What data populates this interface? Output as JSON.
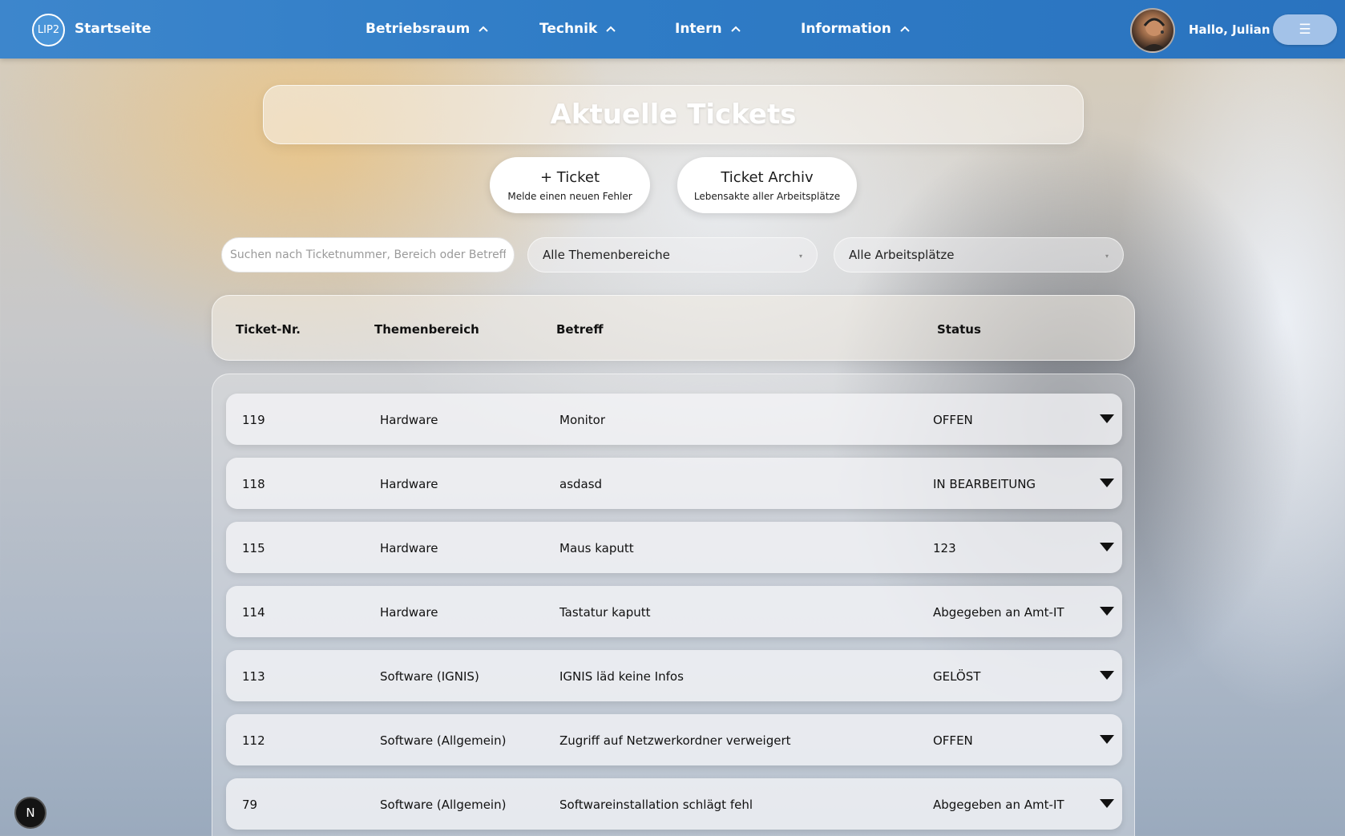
{
  "navbar": {
    "logo_text": "LIP2",
    "brand": "Startseite",
    "items": [
      {
        "label": "Betriebsraum"
      },
      {
        "label": "Technik"
      },
      {
        "label": "Intern"
      },
      {
        "label": "Information"
      }
    ],
    "greeting": "Hallo, Julian",
    "menu_icon": "☰"
  },
  "page": {
    "title": "Aktuelle Tickets",
    "new_ticket": {
      "label": "+ Ticket",
      "sub": "Melde einen neuen Fehler"
    },
    "archive": {
      "label": "Ticket Archiv",
      "sub": "Lebensakte aller Arbeitsplätze"
    }
  },
  "filters": {
    "search_placeholder": "Suchen nach Ticketnummer, Bereich oder Betreff",
    "topic_selected": "Alle Themenbereiche",
    "workplace_selected": "Alle Arbeitsplätze"
  },
  "table": {
    "headers": {
      "nr": "Ticket-Nr.",
      "area": "Themenbereich",
      "subject": "Betreff",
      "status": "Status"
    },
    "rows": [
      {
        "nr": "119",
        "area": "Hardware",
        "subject": "Monitor",
        "status": "OFFEN"
      },
      {
        "nr": "118",
        "area": "Hardware",
        "subject": "asdasd",
        "status": "IN BEARBEITUNG"
      },
      {
        "nr": "115",
        "area": "Hardware",
        "subject": "Maus kaputt",
        "status": "123"
      },
      {
        "nr": "114",
        "area": "Hardware",
        "subject": "Tastatur kaputt",
        "status": "Abgegeben an Amt-IT"
      },
      {
        "nr": "113",
        "area": "Software (IGNIS)",
        "subject": "IGNIS läd keine Infos",
        "status": "GELÖST"
      },
      {
        "nr": "112",
        "area": "Software (Allgemein)",
        "subject": "Zugriff auf Netzwerkordner verweigert",
        "status": "OFFEN"
      },
      {
        "nr": "79",
        "area": "Software (Allgemein)",
        "subject": "Softwareinstallation schlägt fehl",
        "status": "Abgegeben an Amt-IT"
      }
    ]
  },
  "badge": {
    "letter": "N"
  }
}
